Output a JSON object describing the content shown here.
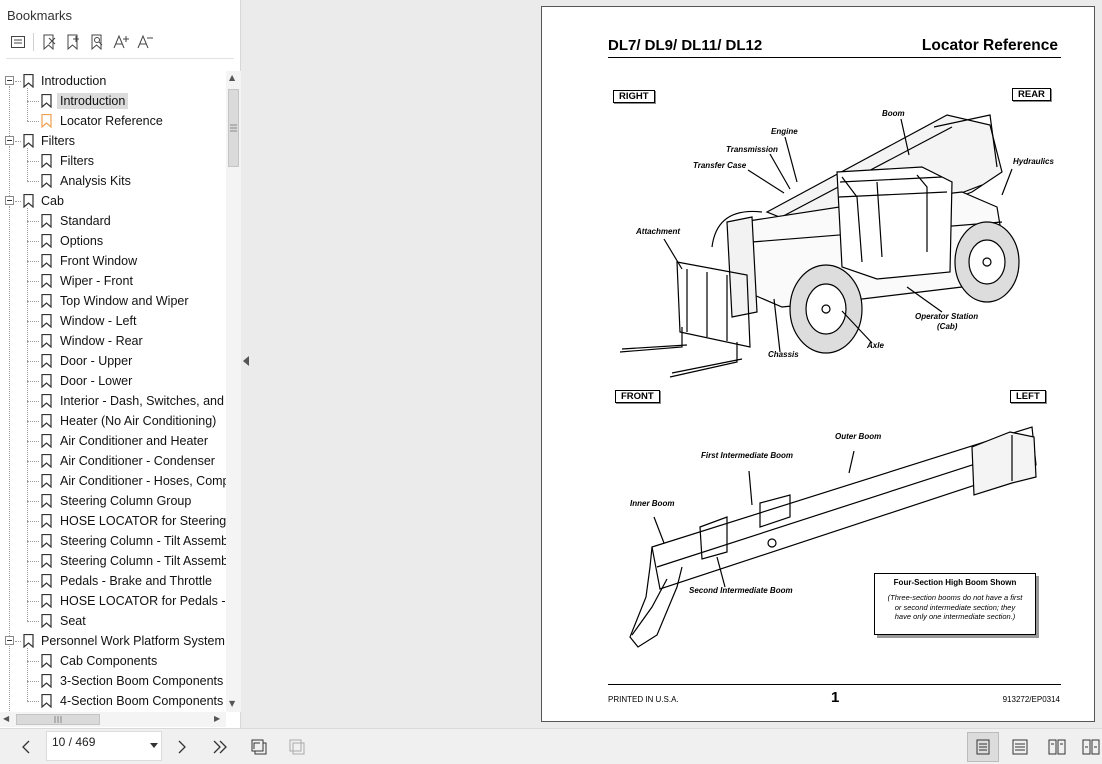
{
  "sidebar": {
    "title": "Bookmarks",
    "toolbar": [
      "bookmark-menu-icon",
      "delete-bookmark-icon",
      "add-bookmark-icon",
      "find-bookmark-icon",
      "increase-font-icon",
      "decrease-font-icon"
    ],
    "selected": "Introduction",
    "items": [
      {
        "label": "Introduction",
        "level": 0,
        "expanded": true
      },
      {
        "label": "Introduction",
        "level": 1,
        "selected": true
      },
      {
        "label": "Locator Reference",
        "level": 1,
        "accent": true
      },
      {
        "label": "Filters",
        "level": 0,
        "expanded": true
      },
      {
        "label": "Filters",
        "level": 1
      },
      {
        "label": "Analysis Kits",
        "level": 1
      },
      {
        "label": "Cab",
        "level": 0,
        "expanded": true
      },
      {
        "label": "Standard",
        "level": 1
      },
      {
        "label": "Options",
        "level": 1
      },
      {
        "label": "Front Window",
        "level": 1
      },
      {
        "label": "Wiper - Front",
        "level": 1
      },
      {
        "label": "Top Window and Wiper",
        "level": 1
      },
      {
        "label": "Window - Left",
        "level": 1
      },
      {
        "label": "Window - Rear",
        "level": 1
      },
      {
        "label": "Door - Upper",
        "level": 1
      },
      {
        "label": "Door - Lower",
        "level": 1
      },
      {
        "label": "Interior - Dash, Switches, and Pa",
        "level": 1
      },
      {
        "label": "Heater (No Air Conditioning)",
        "level": 1
      },
      {
        "label": "Air Conditioner and Heater",
        "level": 1
      },
      {
        "label": "Air Conditioner - Condenser",
        "level": 1
      },
      {
        "label": "Air Conditioner - Hoses, Compr",
        "level": 1
      },
      {
        "label": "Steering Column Group",
        "level": 1
      },
      {
        "label": "HOSE LOCATOR for Steering Co",
        "level": 1
      },
      {
        "label": "Steering Column - Tilt Assembl",
        "level": 1
      },
      {
        "label": "Steering Column - Tilt Assembl",
        "level": 1
      },
      {
        "label": "Pedals - Brake and Throttle",
        "level": 1
      },
      {
        "label": "HOSE LOCATOR for Pedals - Br",
        "level": 1
      },
      {
        "label": "Seat",
        "level": 1
      },
      {
        "label": "Personnel Work Platform System",
        "level": 0,
        "expanded": true
      },
      {
        "label": "Cab Components",
        "level": 1
      },
      {
        "label": "3-Section Boom Components (",
        "level": 1
      },
      {
        "label": "4-Section Boom Components (",
        "level": 1
      }
    ]
  },
  "document": {
    "header_left": "DL7/ DL9/ DL11/ DL12",
    "header_right": "Locator Reference",
    "top_diagram": {
      "corner_labels": {
        "right": "RIGHT",
        "rear": "REAR"
      },
      "callouts": {
        "boom": "Boom",
        "engine": "Engine",
        "transmission": "Transmission",
        "transfer_case": "Transfer Case",
        "hydraulics": "Hydraulics",
        "attachment": "Attachment",
        "operator_station_1": "Operator Station",
        "operator_station_2": "(Cab)",
        "axle": "Axle",
        "chassis": "Chassis"
      }
    },
    "bottom_diagram": {
      "corner_labels": {
        "front": "FRONT",
        "left": "LEFT"
      },
      "callouts": {
        "outer_boom": "Outer Boom",
        "first_intermediate": "First Intermediate Boom",
        "inner_boom": "Inner Boom",
        "second_intermediate": "Second Intermediate Boom"
      },
      "note_title": "Four-Section High Boom Shown",
      "note_lines": [
        "(Three-section booms do not have a first",
        "or second intermediate section; they",
        "have only one intermediate section.)"
      ]
    },
    "footer_left": "PRINTED IN U.S.A.",
    "page_number": "1",
    "footer_right": "913272/EP0314"
  },
  "navigation": {
    "page_indicator": "10 / 469"
  },
  "colors": {
    "bookmark_accent": "#f0a050",
    "selection": "#dcdcdc"
  }
}
